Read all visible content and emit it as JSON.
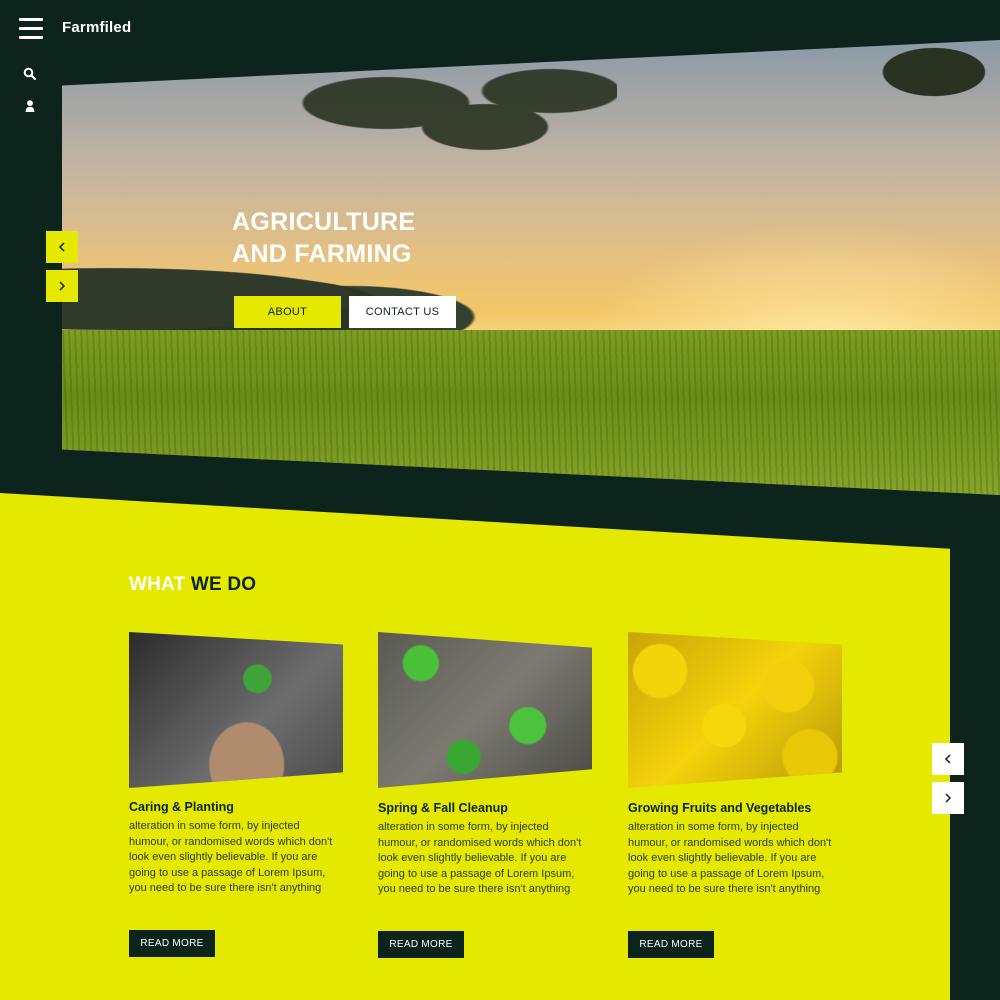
{
  "brand": "Farmfiled",
  "hero": {
    "title_line1": "AGRICULTURE",
    "title_line2": "AND FARMING",
    "about_label": "ABOUT",
    "contact_label": "CONTACT US"
  },
  "section": {
    "title_a": "WHAT",
    "title_b": "WE DO"
  },
  "cards": [
    {
      "title": "Caring & Planting",
      "text": "alteration in some form, by injected humour, or randomised words which don't look even slightly believable. If you are going to use a passage of Lorem Ipsum, you need to be sure there isn't anything",
      "button": "READ MORE"
    },
    {
      "title": "Spring & Fall Cleanup",
      "text": "alteration in some form, by injected humour, or randomised words which don't look even slightly believable. If you are going to use a passage of Lorem Ipsum, you need to be sure there isn't anything",
      "button": "READ MORE"
    },
    {
      "title": "Growing Fruits and Vegetables",
      "text": "alteration in some form, by injected humour, or randomised words which don't look even slightly believable. If you are going to use a passage of Lorem Ipsum, you need to be sure there isn't anything",
      "button": "READ MORE"
    }
  ],
  "icons": {
    "menu": "menu-icon",
    "search": "search-icon",
    "user": "user-icon",
    "prev": "chevron-left-icon",
    "next": "chevron-right-icon"
  },
  "colors": {
    "dark": "#0d241d",
    "accent": "#e5e900",
    "white": "#ffffff"
  }
}
